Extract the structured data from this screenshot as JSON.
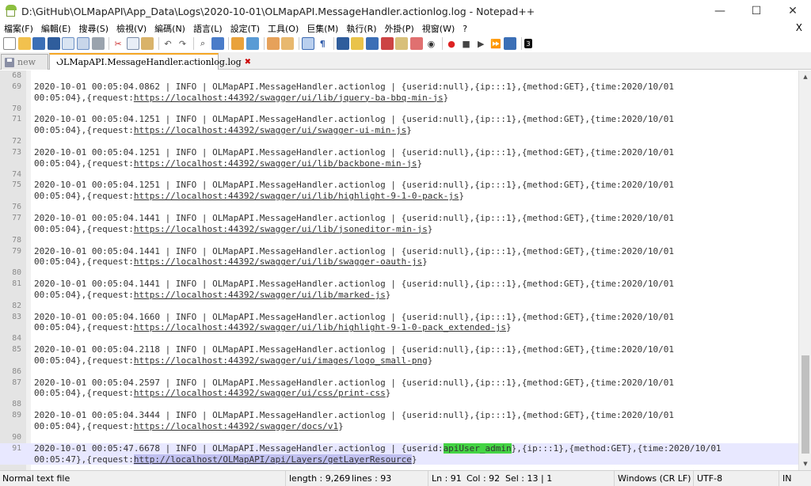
{
  "window": {
    "title": "D:\\GitHub\\OLMapAPI\\App_Data\\Logs\\2020-10-01\\OLMapAPI.MessageHandler.actionlog.log - Notepad++",
    "minimize": "—",
    "maximize": "☐",
    "close": "✕"
  },
  "menu": {
    "items": [
      "檔案(F)",
      "編輯(E)",
      "搜尋(S)",
      "檢視(V)",
      "編碼(N)",
      "語言(L)",
      "設定(T)",
      "工具(O)",
      "巨集(M)",
      "執行(R)",
      "外掛(P)",
      "視窗(W)",
      "?"
    ],
    "close": "X"
  },
  "toolbar": {
    "icons": [
      "new-file-icon",
      "open-file-icon",
      "save-icon",
      "save-all-icon",
      "close-file-icon",
      "close-all-icon",
      "print-icon",
      "cut-icon",
      "copy-icon",
      "paste-icon",
      "undo-icon",
      "redo-icon",
      "find-icon",
      "replace-icon",
      "zoom-in-icon",
      "zoom-out-icon",
      "sync-v-icon",
      "sync-h-icon",
      "word-wrap-icon",
      "show-all-chars-icon",
      "indent-guide-icon",
      "udl-icon",
      "doc-map-icon",
      "function-list-icon",
      "folder-workspace-icon",
      "monitor-icon",
      "record-macro-icon",
      "stop-macro-icon",
      "play-macro-icon",
      "run-macro-multiple-icon",
      "save-macro-icon",
      "plugin-icon"
    ]
  },
  "tabs": [
    {
      "label": "new",
      "active": false
    },
    {
      "label": "OLMapAPI.MessageHandler.actionlog.log",
      "active": true
    }
  ],
  "editor": {
    "lines": [
      {
        "n": "68",
        "text": ""
      },
      {
        "n": "69",
        "text": "2020-10-01 00:05:04.0862 | INFO | OLMapAPI.MessageHandler.actionlog | {userid:null},{ip:::1},{method:GET},{time:2020/10/01",
        "pre": "00:05:04},{request:",
        "url": "https://localhost:44392/swagger/ui/lib/jquery-ba-bbq-min-js",
        "post": "}"
      },
      {
        "n": "70",
        "text": ""
      },
      {
        "n": "71",
        "text": "2020-10-01 00:05:04.1251 | INFO | OLMapAPI.MessageHandler.actionlog | {userid:null},{ip:::1},{method:GET},{time:2020/10/01",
        "pre": "00:05:04},{request:",
        "url": "https://localhost:44392/swagger/ui/swagger-ui-min-js",
        "post": "}"
      },
      {
        "n": "72",
        "text": ""
      },
      {
        "n": "73",
        "text": "2020-10-01 00:05:04.1251 | INFO | OLMapAPI.MessageHandler.actionlog | {userid:null},{ip:::1},{method:GET},{time:2020/10/01",
        "pre": "00:05:04},{request:",
        "url": "https://localhost:44392/swagger/ui/lib/backbone-min-js",
        "post": "}"
      },
      {
        "n": "74",
        "text": ""
      },
      {
        "n": "75",
        "text": "2020-10-01 00:05:04.1251 | INFO | OLMapAPI.MessageHandler.actionlog | {userid:null},{ip:::1},{method:GET},{time:2020/10/01",
        "pre": "00:05:04},{request:",
        "url": "https://localhost:44392/swagger/ui/lib/highlight-9-1-0-pack-js",
        "post": "}"
      },
      {
        "n": "76",
        "text": ""
      },
      {
        "n": "77",
        "text": "2020-10-01 00:05:04.1441 | INFO | OLMapAPI.MessageHandler.actionlog | {userid:null},{ip:::1},{method:GET},{time:2020/10/01",
        "pre": "00:05:04},{request:",
        "url": "https://localhost:44392/swagger/ui/lib/jsoneditor-min-js",
        "post": "}"
      },
      {
        "n": "78",
        "text": ""
      },
      {
        "n": "79",
        "text": "2020-10-01 00:05:04.1441 | INFO | OLMapAPI.MessageHandler.actionlog | {userid:null},{ip:::1},{method:GET},{time:2020/10/01",
        "pre": "00:05:04},{request:",
        "url": "https://localhost:44392/swagger/ui/lib/swagger-oauth-js",
        "post": "}"
      },
      {
        "n": "80",
        "text": ""
      },
      {
        "n": "81",
        "text": "2020-10-01 00:05:04.1441 | INFO | OLMapAPI.MessageHandler.actionlog | {userid:null},{ip:::1},{method:GET},{time:2020/10/01",
        "pre": "00:05:04},{request:",
        "url": "https://localhost:44392/swagger/ui/lib/marked-js",
        "post": "}"
      },
      {
        "n": "82",
        "text": ""
      },
      {
        "n": "83",
        "text": "2020-10-01 00:05:04.1660 | INFO | OLMapAPI.MessageHandler.actionlog | {userid:null},{ip:::1},{method:GET},{time:2020/10/01",
        "pre": "00:05:04},{request:",
        "url": "https://localhost:44392/swagger/ui/lib/highlight-9-1-0-pack_extended-js",
        "post": "}"
      },
      {
        "n": "84",
        "text": ""
      },
      {
        "n": "85",
        "text": "2020-10-01 00:05:04.2118 | INFO | OLMapAPI.MessageHandler.actionlog | {userid:null},{ip:::1},{method:GET},{time:2020/10/01",
        "pre": "00:05:04},{request:",
        "url": "https://localhost:44392/swagger/ui/images/logo_small-png",
        "post": "}"
      },
      {
        "n": "86",
        "text": ""
      },
      {
        "n": "87",
        "text": "2020-10-01 00:05:04.2597 | INFO | OLMapAPI.MessageHandler.actionlog | {userid:null},{ip:::1},{method:GET},{time:2020/10/01",
        "pre": "00:05:04},{request:",
        "url": "https://localhost:44392/swagger/ui/css/print-css",
        "post": "}"
      },
      {
        "n": "88",
        "text": ""
      },
      {
        "n": "89",
        "text": "2020-10-01 00:05:04.3444 | INFO | OLMapAPI.MessageHandler.actionlog | {userid:null},{ip:::1},{method:GET},{time:2020/10/01",
        "pre": "00:05:04},{request:",
        "url": "https://localhost:44392/swagger/docs/v1",
        "post": "}"
      },
      {
        "n": "90",
        "text": ""
      }
    ],
    "last_line": {
      "n": "91",
      "a": "2020-10-01 00:05:47.6678 | INFO | OLMapAPI.MessageHandler.actionlog | {userid:",
      "hl": "apiUser_admin",
      "b": "},{ip:::1},{method:GET},{time:2020/10/01",
      "pre": "00:05:47},{request:",
      "url": "http://localhost/OLMapAPI/api/Layers/getLayerResource",
      "post": "}"
    }
  },
  "scrollbar": {
    "up": "▲",
    "down": "▼"
  },
  "status": {
    "file_type": "Normal text file",
    "length": "length : 9,269",
    "lines": "lines : 93",
    "ln": "Ln : 91",
    "col": "Col : 92",
    "sel": "Sel : 13 | 1",
    "eol": "Windows (CR LF)",
    "encoding": "UTF-8",
    "mode": "IN"
  },
  "colors": {
    "current_line": "#e8e8ff",
    "selection": "#c0c0f0",
    "smart_highlight": "#44d444",
    "tab_accent": "#f5a623"
  }
}
